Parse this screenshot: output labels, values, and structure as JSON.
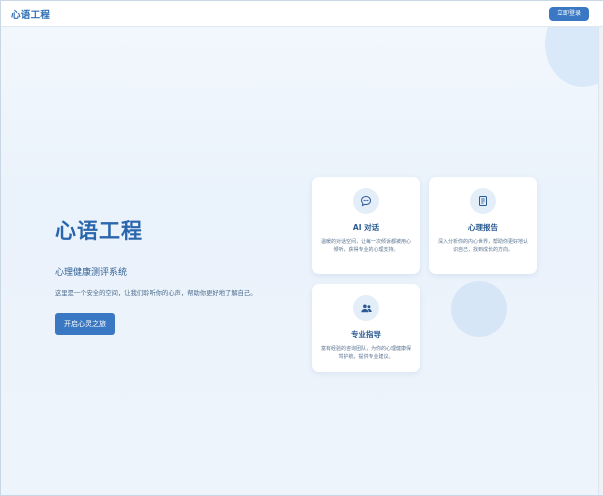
{
  "header": {
    "brand": "心语工程",
    "login_label": "立即登录"
  },
  "hero": {
    "title": "心语工程",
    "subtitle": "心理健康测评系统",
    "description": "这里是一个安全的空间，让我们聆听你的心声，帮助你更好地了解自己。",
    "cta_label": "开启心灵之旅"
  },
  "features": [
    {
      "icon": "chat-bubble-icon",
      "title": "AI 对话",
      "description": "温暖的对话空间，让每一次倾诉都被用心倾听，获得专业的心理支持。"
    },
    {
      "icon": "report-document-icon",
      "title": "心理报告",
      "description": "深入分析你的内心世界，帮助你更好地认识自己，找到成长的方向。"
    },
    {
      "icon": "users-group-icon",
      "title": "专业指导",
      "description": "富有经验的咨询团队，为你的心理健康保驾护航，提供专业建议。"
    }
  ],
  "colors": {
    "accent": "#3a78c3",
    "brand_text": "#2f6fb3",
    "card_bg": "#ffffff",
    "page_bg": "#eaf2fb"
  }
}
